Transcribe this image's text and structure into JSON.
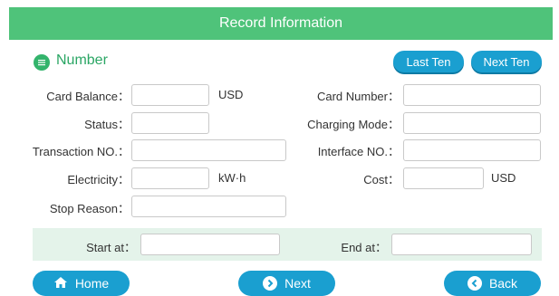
{
  "header": {
    "title": "Record Information"
  },
  "section": {
    "title": "Number"
  },
  "paging": {
    "last_label": "Last Ten",
    "next_label": "Next Ten"
  },
  "fields": {
    "card_balance": {
      "label": "Card Balance：",
      "value": "",
      "unit": "USD"
    },
    "card_number": {
      "label": "Card Number：",
      "value": ""
    },
    "status": {
      "label": "Status：",
      "value": ""
    },
    "charging_mode": {
      "label": "Charging Mode：",
      "value": ""
    },
    "transaction_no": {
      "label": "Transaction NO.：",
      "value": ""
    },
    "interface_no": {
      "label": "Interface NO.：",
      "value": ""
    },
    "electricity": {
      "label": "Electricity：",
      "value": "",
      "unit": "kW·h"
    },
    "cost": {
      "label": "Cost：",
      "value": "",
      "unit": "USD"
    },
    "stop_reason": {
      "label": "Stop Reason：",
      "value": ""
    },
    "start_at": {
      "label": "Start at：",
      "value": ""
    },
    "end_at": {
      "label": "End at：",
      "value": ""
    }
  },
  "nav": {
    "home_label": "Home",
    "next_label": "Next",
    "back_label": "Back"
  },
  "colors": {
    "header": "#4fc37a",
    "accent": "#1a9fd0",
    "section_icon": "#33b46c",
    "time_bar": "#e4f3ea"
  },
  "icons": {
    "section": "list-icon",
    "home": "home-icon",
    "next": "arrow-right-icon",
    "back": "arrow-left-icon"
  }
}
